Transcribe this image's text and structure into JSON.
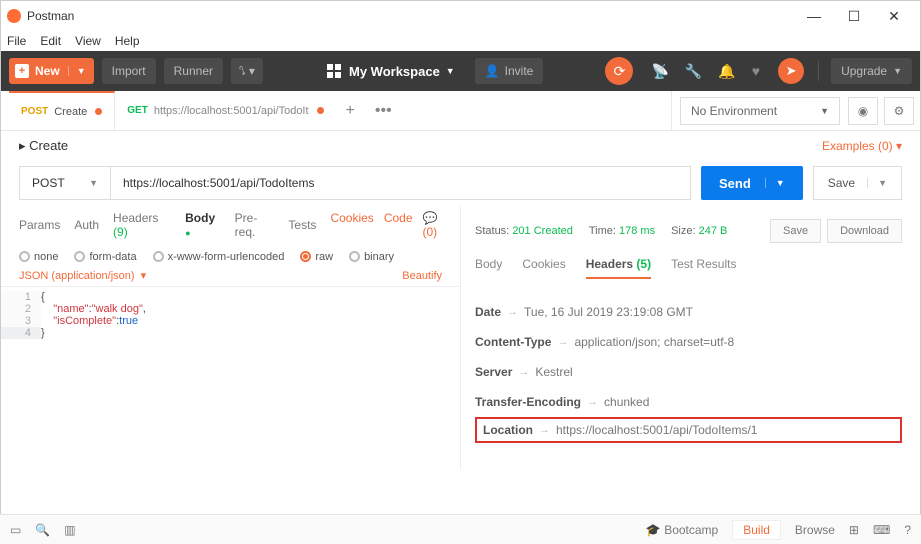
{
  "app": {
    "title": "Postman"
  },
  "menu": {
    "file": "File",
    "edit": "Edit",
    "view": "View",
    "help": "Help"
  },
  "toolbar": {
    "new": "New",
    "import": "Import",
    "runner": "Runner",
    "workspace": "My Workspace",
    "invite": "Invite",
    "upgrade": "Upgrade"
  },
  "tabs": [
    {
      "method": "POST",
      "method_color": "#e6a100",
      "label": "Create",
      "dirty": true,
      "active": true
    },
    {
      "method": "GET",
      "method_color": "#0cbb52",
      "label": "https://localhost:5001/api/TodoIt",
      "dirty": true,
      "active": false
    }
  ],
  "env": {
    "selected": "No Environment"
  },
  "breadcrumb": {
    "label": "Create"
  },
  "examples": {
    "label": "Examples (0)"
  },
  "request": {
    "method": "POST",
    "url": "https://localhost:5001/api/TodoItems",
    "send": "Send",
    "save": "Save"
  },
  "req_tabs": {
    "params": "Params",
    "auth": "Auth",
    "headers": "Headers (9)",
    "body": "Body",
    "prereq": "Pre-req.",
    "tests": "Tests",
    "cookies": "Cookies",
    "code": "Code",
    "comments": "(0)"
  },
  "body_types": {
    "none": "none",
    "formdata": "form-data",
    "xwww": "x-www-form-urlencoded",
    "raw": "raw",
    "binary": "binary"
  },
  "body_format": {
    "label": "JSON (application/json)",
    "beautify": "Beautify"
  },
  "code_lines": [
    "1",
    "2",
    "3",
    "4"
  ],
  "body_json": {
    "l1": "{",
    "l2_indent": "    ",
    "l2_k": "\"name\"",
    "l2_c": ":",
    "l2_v": "\"walk dog\"",
    "l2_e": ",",
    "l3_indent": "    ",
    "l3_k": "\"isComplete\"",
    "l3_c": ":",
    "l3_v": "true",
    "l4": "}"
  },
  "response": {
    "status_label": "Status:",
    "status_value": "201 Created",
    "time_label": "Time:",
    "time_value": "178 ms",
    "size_label": "Size:",
    "size_value": "247 B",
    "save": "Save",
    "download": "Download"
  },
  "resp_tabs": {
    "body": "Body",
    "cookies": "Cookies",
    "headers": "Headers (5)",
    "tests": "Test Results"
  },
  "headers": [
    {
      "k": "Date",
      "v": "Tue, 16 Jul 2019 23:19:08 GMT",
      "hl": false
    },
    {
      "k": "Content-Type",
      "v": "application/json; charset=utf-8",
      "hl": false
    },
    {
      "k": "Server",
      "v": "Kestrel",
      "hl": false
    },
    {
      "k": "Transfer-Encoding",
      "v": "chunked",
      "hl": false
    },
    {
      "k": "Location",
      "v": "https://localhost:5001/api/TodoItems/1",
      "hl": true
    }
  ],
  "statusbar": {
    "bootcamp": "Bootcamp",
    "build": "Build",
    "browse": "Browse"
  }
}
